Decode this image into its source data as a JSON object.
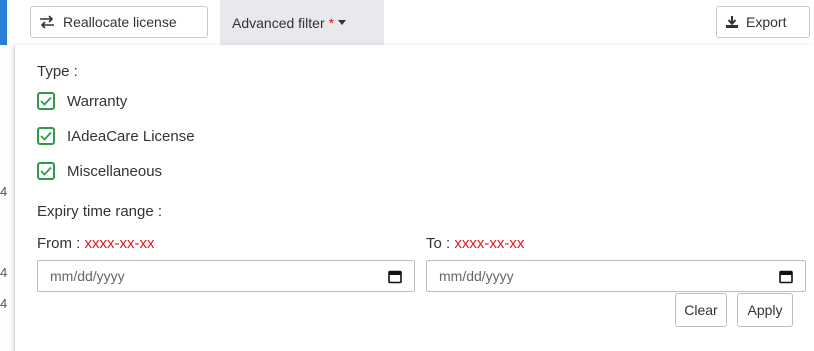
{
  "toolbar": {
    "reallocate_label": "Reallocate license",
    "advanced_filter_label": "Advanced filter",
    "advanced_filter_marker": "*",
    "export_label": "Export"
  },
  "background_fragments": [
    "4",
    "4",
    "4"
  ],
  "filter": {
    "type_label": "Type :",
    "types": [
      {
        "label": "Warranty",
        "checked": true
      },
      {
        "label": "IAdeaCare License",
        "checked": true
      },
      {
        "label": "Miscellaneous",
        "checked": true
      }
    ],
    "expiry_label": "Expiry time range :",
    "from_label": "From :",
    "from_value": "xxxx-xx-xx",
    "to_label": "To :",
    "to_value": "xxxx-xx-xx",
    "from_placeholder": "mm/dd/yyyy",
    "to_placeholder": "mm/dd/yyyy",
    "clear_label": "Clear",
    "apply_label": "Apply"
  },
  "colors": {
    "accent_blue": "#2a80d6",
    "check_green": "#2f9a4a",
    "required_red": "#e0161d",
    "active_tab_bg": "#e7e9ec"
  }
}
